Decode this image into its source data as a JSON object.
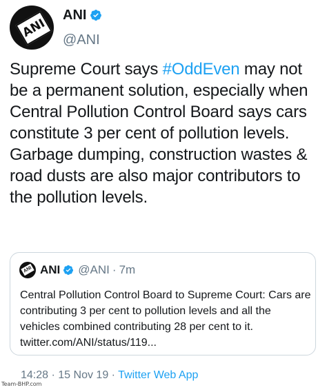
{
  "tweet": {
    "author": {
      "display_name": "ANI",
      "handle": "@ANI",
      "avatar_text": "ANI",
      "verified": true
    },
    "text_prefix": "Supreme Court says ",
    "hashtag": "#OddEven",
    "text_suffix": " may not be a permanent solution, especially when Central Pollution Control Board says cars constitute 3 per cent of pollution levels. Garbage dumping, construction wastes & road dusts are also major contributors to the pollution levels.",
    "quoted": {
      "display_name": "ANI",
      "handle": "@ANI",
      "separator": "·",
      "time_ago": "7m",
      "text": "Central Pollution Control Board to Supreme Court: Cars are contributing 3 per cent to pollution levels and all the vehicles combined contributing 28 per cent to it. twitter.com/ANI/status/119..."
    },
    "footer": {
      "time": "14:28",
      "separator1": "·",
      "date": "15 Nov 19",
      "separator2": "·",
      "source": "Twitter Web App"
    }
  },
  "watermark": "Team-BHP.com",
  "colors": {
    "link": "#1da1f2",
    "muted": "#657786",
    "border": "#ccd6dd"
  }
}
